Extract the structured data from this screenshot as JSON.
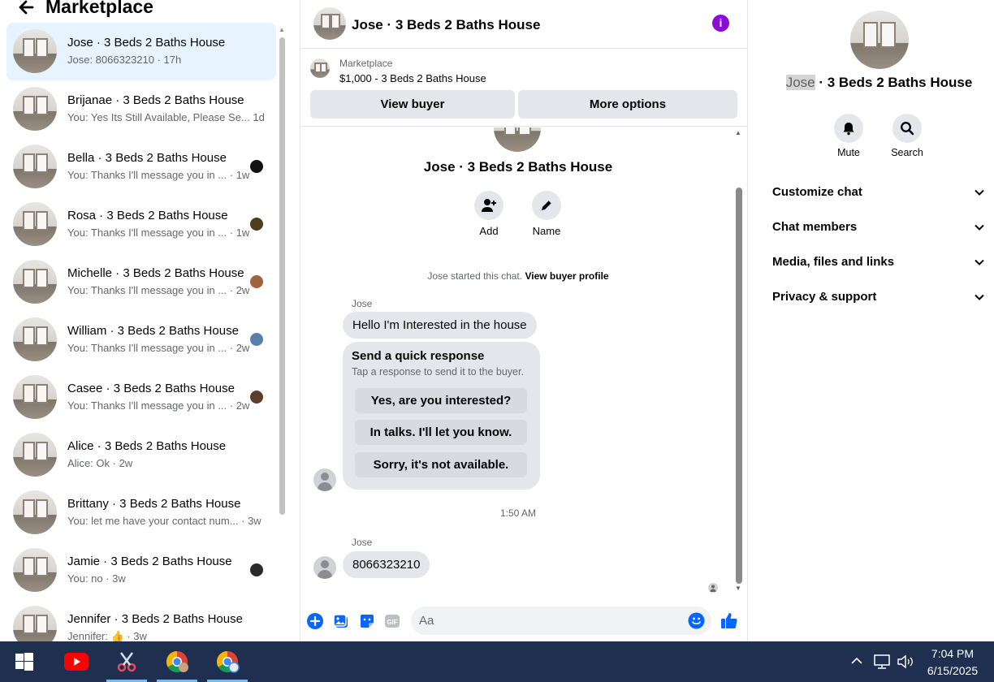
{
  "left_panel": {
    "title": "Marketplace",
    "conversations": [
      {
        "name": "Jose · 3 Beds 2 Baths House",
        "preview": "Jose: 8066323210 · 17h",
        "mini": null,
        "active": true
      },
      {
        "name": "Brijanae · 3 Beds 2 Baths House",
        "preview": "You: Yes Its Still Available, Please Se...  1d",
        "mini": null
      },
      {
        "name": "Bella · 3 Beds 2 Baths House",
        "preview": "You: Thanks I'll message you in ...  · 1w",
        "mini": "#111111"
      },
      {
        "name": "Rosa · 3 Beds 2 Baths House",
        "preview": "You: Thanks I'll message you in ...  · 1w",
        "mini": "#4a4020"
      },
      {
        "name": "Michelle · 3 Beds 2 Baths House",
        "preview": "You: Thanks I'll message you in ...  · 2w",
        "mini": "#a0633e"
      },
      {
        "name": "William · 3 Beds 2 Baths House",
        "preview": "You: Thanks I'll message you in ...  · 2w",
        "mini": "#5a7fa8"
      },
      {
        "name": "Casee · 3 Beds 2 Baths House",
        "preview": "You: Thanks I'll message you in ...  · 2w",
        "mini": "#5b3d2e"
      },
      {
        "name": "Alice · 3 Beds 2 Baths House",
        "preview": "Alice: Ok · 2w",
        "mini": null
      },
      {
        "name": "Brittany · 3 Beds 2 Baths House",
        "preview": "You: let me have your contact num...  · 3w",
        "mini": null
      },
      {
        "name": "Jamie · 3 Beds 2 Baths House",
        "preview": "You: no · 3w",
        "mini": "#2a2a2a"
      },
      {
        "name": "Jennifer · 3 Beds 2 Baths House",
        "preview": "Jennifer: 👍 · 3w",
        "mini": null
      }
    ]
  },
  "chat": {
    "title": "Jose · 3 Beds 2 Baths House",
    "listing_label": "Marketplace",
    "listing_price": "$1,000 - 3 Beds 2 Baths House",
    "view_buyer": "View buyer",
    "more_options": "More options",
    "thread_title": "Jose · 3 Beds 2 Baths House",
    "add_label": "Add",
    "name_label": "Name",
    "started_text": "Jose started this chat.",
    "started_link": "View buyer profile",
    "sender1": "Jose",
    "message1": "Hello I'm Interested in the house",
    "quick_title": "Send a quick response",
    "quick_sub": "Tap a response to send it to the buyer.",
    "quick_options": [
      "Yes, are you interested?",
      "In talks. I'll let you know.",
      "Sorry, it's not available."
    ],
    "timestamp": "1:50 AM",
    "sender2": "Jose",
    "message2": "8066323210",
    "composer_placeholder": "Aa"
  },
  "details": {
    "title_highlight": "Jose",
    "title_rest": " · 3 Beds 2 Baths House",
    "mute": "Mute",
    "search": "Search",
    "sections": [
      "Customize chat",
      "Chat members",
      "Media, files and links",
      "Privacy & support"
    ]
  },
  "taskbar": {
    "time": "7:04 PM",
    "date": "6/15/2025"
  },
  "colors": {
    "accent": "#0866ff",
    "info": "#8d0bd7",
    "active_row": "#e7f3ff",
    "taskbar": "#1f2f4f"
  }
}
